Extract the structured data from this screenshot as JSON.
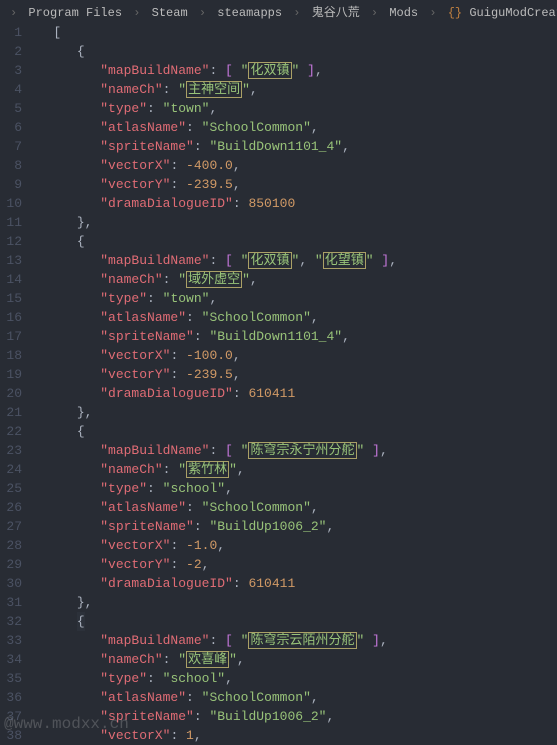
{
  "breadcrumb": {
    "p1": "Program Files",
    "p2": "Steam",
    "p3": "steamapps",
    "p4": "鬼谷八荒",
    "p5": "Mods",
    "p6": "GuiguModCreateTool.json"
  },
  "watermark": "@www.modxx.cn",
  "code": {
    "lines": [
      {
        "n": 1,
        "t": "b",
        "txt": "["
      },
      {
        "n": 2,
        "t": "b",
        "txt": "{"
      },
      {
        "n": 3,
        "t": "kv_arr1",
        "k": "mapBuildName",
        "v1": "化双镇"
      },
      {
        "n": 4,
        "t": "kv_box",
        "k": "nameCh",
        "v": "主神空间"
      },
      {
        "n": 5,
        "t": "kv_str",
        "k": "type",
        "v": "town"
      },
      {
        "n": 6,
        "t": "kv_str",
        "k": "atlasName",
        "v": "SchoolCommon"
      },
      {
        "n": 7,
        "t": "kv_str",
        "k": "spriteName",
        "v": "BuildDown1101_4"
      },
      {
        "n": 8,
        "t": "kv_num",
        "k": "vectorX",
        "v": "-400.0"
      },
      {
        "n": 9,
        "t": "kv_num",
        "k": "vectorY",
        "v": "-239.5"
      },
      {
        "n": 10,
        "t": "kv_numl",
        "k": "dramaDialogueID",
        "v": "850100"
      },
      {
        "n": 11,
        "t": "eb",
        "txt": "},"
      },
      {
        "n": 12,
        "t": "b",
        "txt": "{"
      },
      {
        "n": 13,
        "t": "kv_arr2",
        "k": "mapBuildName",
        "v1": "化双镇",
        "v2": "化望镇"
      },
      {
        "n": 14,
        "t": "kv_box",
        "k": "nameCh",
        "v": "域外虚空"
      },
      {
        "n": 15,
        "t": "kv_str",
        "k": "type",
        "v": "town"
      },
      {
        "n": 16,
        "t": "kv_str",
        "k": "atlasName",
        "v": "SchoolCommon"
      },
      {
        "n": 17,
        "t": "kv_str",
        "k": "spriteName",
        "v": "BuildDown1101_4"
      },
      {
        "n": 18,
        "t": "kv_num",
        "k": "vectorX",
        "v": "-100.0"
      },
      {
        "n": 19,
        "t": "kv_num",
        "k": "vectorY",
        "v": "-239.5"
      },
      {
        "n": 20,
        "t": "kv_numl",
        "k": "dramaDialogueID",
        "v": "610411"
      },
      {
        "n": 21,
        "t": "eb",
        "txt": "},"
      },
      {
        "n": 22,
        "t": "b",
        "txt": "{"
      },
      {
        "n": 23,
        "t": "kv_arr1",
        "k": "mapBuildName",
        "v1": "陈穹宗永宁州分舵"
      },
      {
        "n": 24,
        "t": "kv_box",
        "k": "nameCh",
        "v": "紫竹林"
      },
      {
        "n": 25,
        "t": "kv_str",
        "k": "type",
        "v": "school"
      },
      {
        "n": 26,
        "t": "kv_str",
        "k": "atlasName",
        "v": "SchoolCommon"
      },
      {
        "n": 27,
        "t": "kv_str",
        "k": "spriteName",
        "v": "BuildUp1006_2"
      },
      {
        "n": 28,
        "t": "kv_num",
        "k": "vectorX",
        "v": "-1.0"
      },
      {
        "n": 29,
        "t": "kv_num",
        "k": "vectorY",
        "v": "-2"
      },
      {
        "n": 30,
        "t": "kv_numl",
        "k": "dramaDialogueID",
        "v": "610411"
      },
      {
        "n": 31,
        "t": "eb",
        "txt": "},"
      },
      {
        "n": 32,
        "t": "cursor",
        "txt": "{"
      },
      {
        "n": 33,
        "t": "kv_arr1",
        "k": "mapBuildName",
        "v1": "陈穹宗云陌州分舵"
      },
      {
        "n": 34,
        "t": "kv_box",
        "k": "nameCh",
        "v": "欢喜峰"
      },
      {
        "n": 35,
        "t": "kv_str",
        "k": "type",
        "v": "school"
      },
      {
        "n": 36,
        "t": "kv_str",
        "k": "atlasName",
        "v": "SchoolCommon"
      },
      {
        "n": 37,
        "t": "kv_str",
        "k": "spriteName",
        "v": "BuildUp1006_2"
      },
      {
        "n": 38,
        "t": "kv_num",
        "k": "vectorX",
        "v": "1"
      }
    ]
  }
}
